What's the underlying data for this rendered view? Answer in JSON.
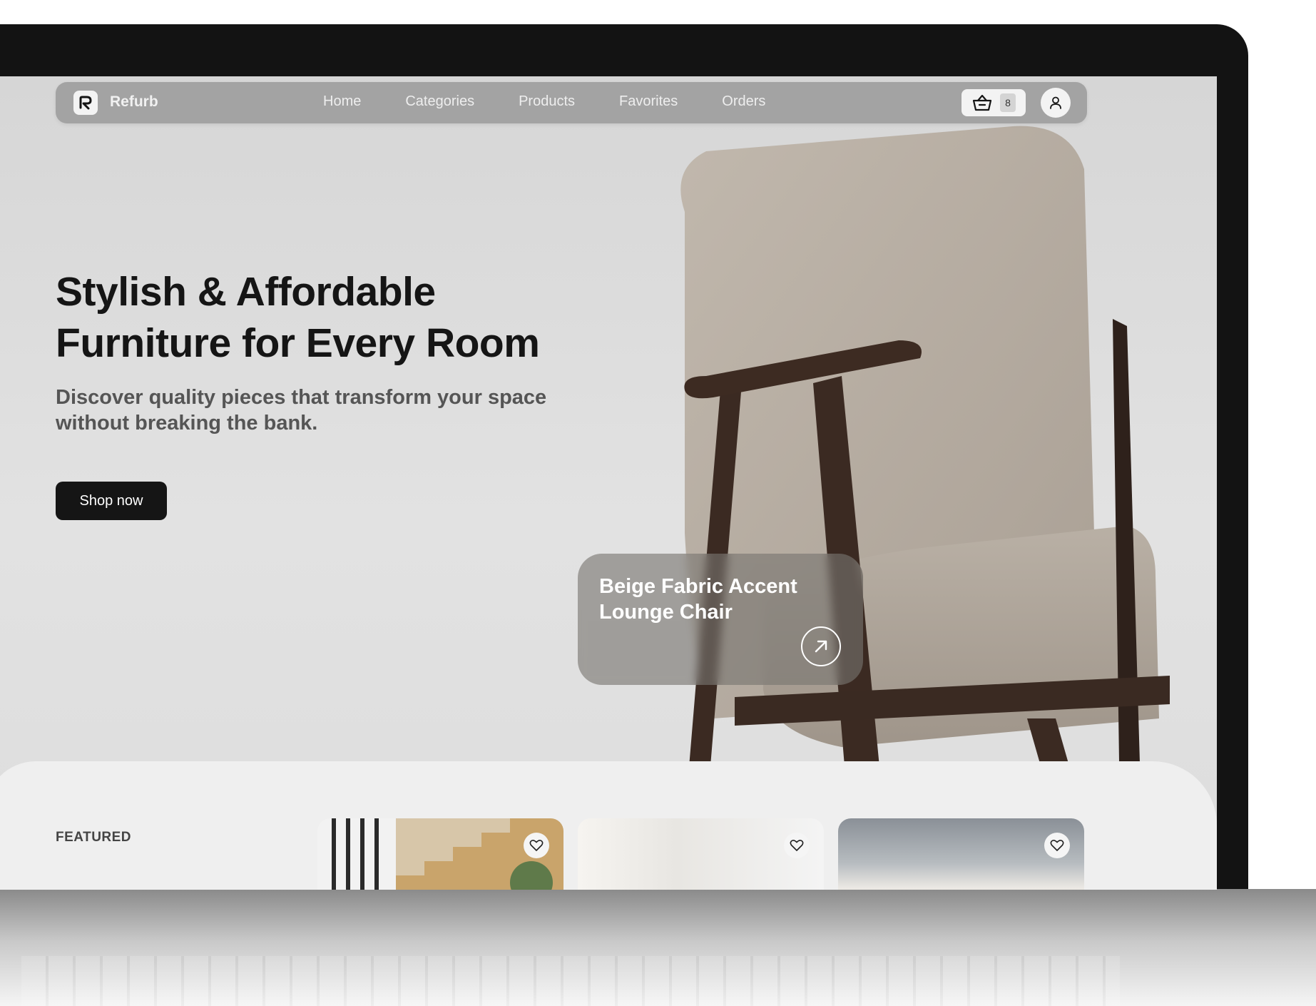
{
  "brand": {
    "name": "Refurb"
  },
  "nav": {
    "links": [
      "Home",
      "Categories",
      "Products",
      "Favorites",
      "Orders"
    ],
    "cart_count": "8"
  },
  "hero": {
    "title_line1": "Stylish & Affordable",
    "title_line2": "Furniture for Every Room",
    "subtitle_line1": "Discover quality pieces that transform your space",
    "subtitle_line2": "without breaking the bank.",
    "cta": "Shop now"
  },
  "product_card": {
    "name_line1": "Beige Fabric Accent",
    "name_line2": "Lounge Chair"
  },
  "featured": {
    "label": "FEATURED"
  },
  "colors": {
    "nav_bg": "#a3a3a3",
    "cta_bg": "#151515",
    "screen_bg": "#d9d9d9",
    "chair_fabric": "#b3aa9f",
    "chair_wood": "#3b2a22"
  },
  "icons": [
    "refurb-logo-icon",
    "basket-icon",
    "user-icon",
    "arrow-up-right-icon",
    "heart-icon"
  ]
}
